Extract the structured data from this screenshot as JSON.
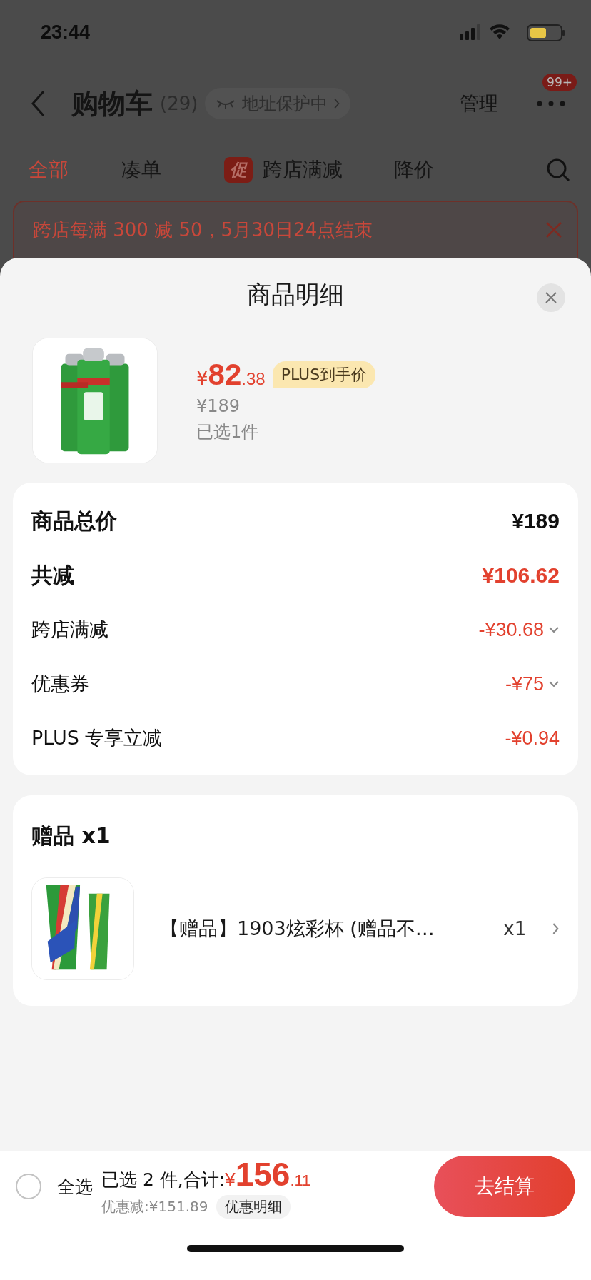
{
  "status_bar": {
    "time": "23:44"
  },
  "header": {
    "title": "购物车",
    "count": "(29)",
    "address_badge": "地址保护中",
    "manage": "管理",
    "more_badge": "99+"
  },
  "tabs": [
    {
      "label": "全部",
      "selected": true
    },
    {
      "label": "凑单",
      "selected": false
    },
    {
      "label": "跨店满减",
      "selected": false,
      "tag": "促"
    },
    {
      "label": "降价",
      "selected": false
    }
  ],
  "banner": {
    "text": "跨店每满 300 减 50，5月30日24点结束"
  },
  "sheet": {
    "title": "商品明细",
    "product": {
      "currency": "¥",
      "price_int": "82",
      "price_dec": ".38",
      "plus_tag": "PLUS到手价",
      "original_price": "¥189",
      "selected_count": "已选1件"
    },
    "summary": [
      {
        "kind": "total",
        "label": "商品总价",
        "value": "¥189"
      },
      {
        "kind": "discount_total",
        "label": "共减",
        "value": "¥106.62"
      },
      {
        "kind": "discount",
        "label": "跨店满减",
        "value": "-¥30.68",
        "expandable": true
      },
      {
        "kind": "discount",
        "label": "优惠券",
        "value": "-¥75",
        "expandable": true
      },
      {
        "kind": "discount",
        "label": "PLUS 专享立减",
        "value": "-¥0.94",
        "expandable": false
      }
    ],
    "gifts": {
      "title": "赠品 x1",
      "items": [
        {
          "name": "【赠品】1903炫彩杯 (赠品不…",
          "qty": "x1"
        }
      ]
    }
  },
  "footer": {
    "select_all": {
      "label": "全选",
      "checked": false
    },
    "summary": "已选 2 件,合计:",
    "currency": "¥",
    "total_int": "156",
    "total_dec": ".11",
    "saving": "优惠减:¥151.89",
    "saving_link": "优惠明细",
    "checkout": "去结算"
  }
}
